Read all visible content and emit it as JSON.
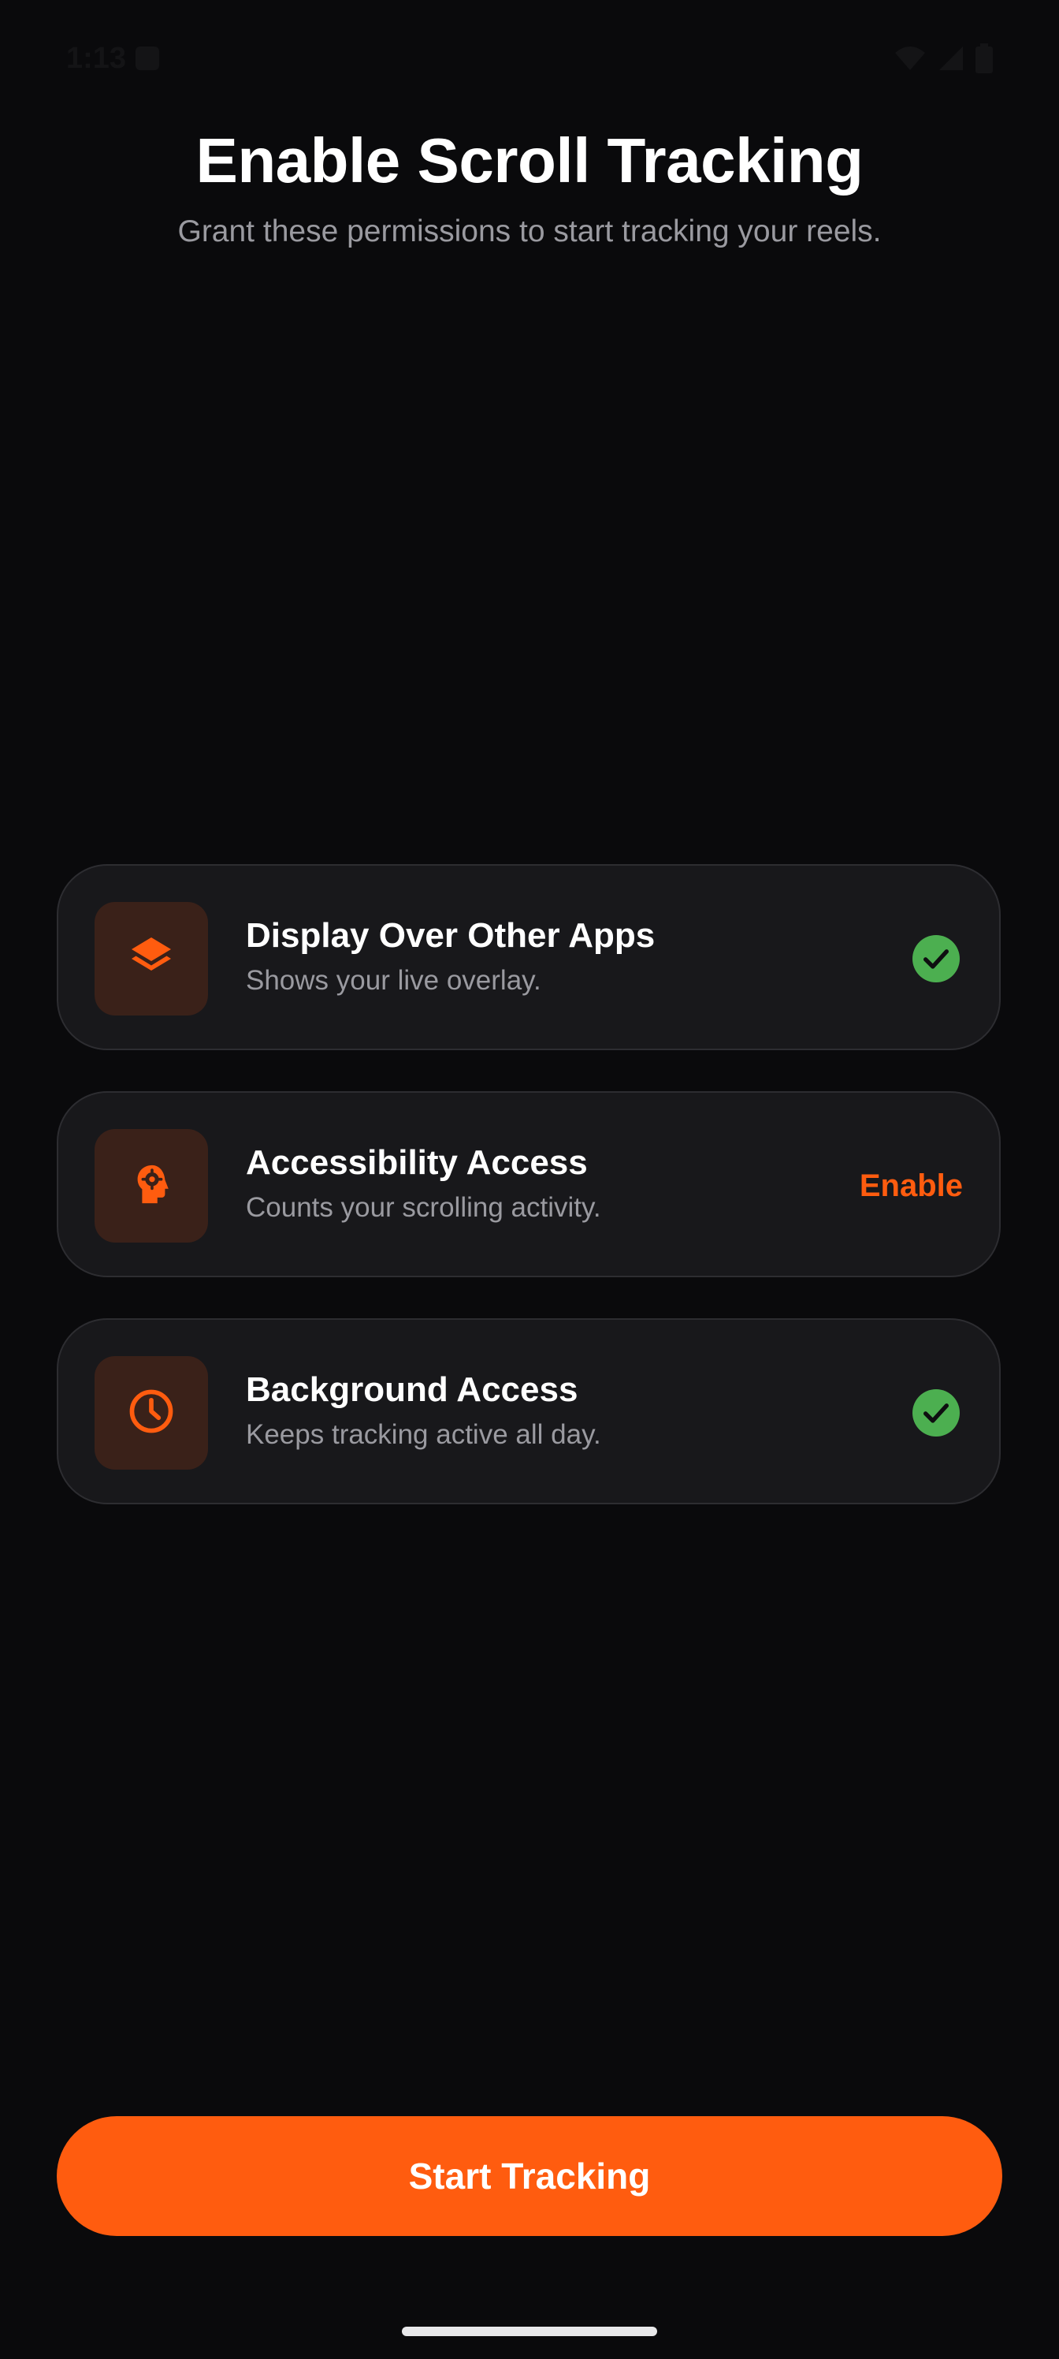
{
  "status_bar": {
    "time": "1:13"
  },
  "header": {
    "title": "Enable Scroll Tracking",
    "subtitle": "Grant these permissions to start tracking your reels."
  },
  "permissions": [
    {
      "title": "Display Over Other Apps",
      "description": "Shows your live overlay.",
      "icon": "layers-icon",
      "status": "granted"
    },
    {
      "title": "Accessibility Access",
      "description": "Counts your scrolling activity.",
      "icon": "head-gear-icon",
      "status": "not_granted",
      "action_label": "Enable"
    },
    {
      "title": "Background Access",
      "description": "Keeps tracking active all day.",
      "icon": "clock-icon",
      "status": "granted"
    }
  ],
  "cta": {
    "label": "Start Tracking"
  },
  "colors": {
    "accent": "#ff5c0f",
    "success": "#4caf50",
    "background": "#0a0a0c",
    "card": "#18181b",
    "icon_tile": "#3a2119",
    "muted_text": "#9a9aa0"
  }
}
